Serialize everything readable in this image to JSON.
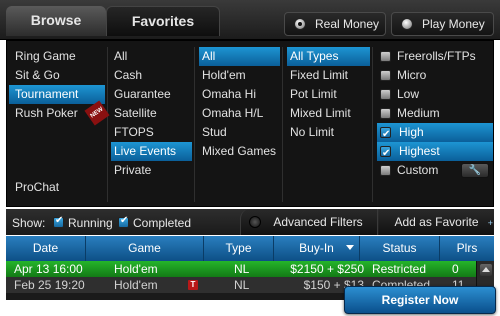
{
  "tabs": {
    "browse": "Browse",
    "favorites": "Favorites"
  },
  "money": {
    "real": "Real Money",
    "play": "Play Money",
    "selected": "real"
  },
  "game_types": {
    "items": [
      "Ring Game",
      "Sit & Go",
      "Tournament",
      "Rush Poker"
    ],
    "selected": "Tournament",
    "new_badge": "NEW",
    "prochat": "ProChat"
  },
  "categories": {
    "items": [
      "All",
      "Cash",
      "Guarantee",
      "Satellite",
      "FTOPS",
      "Live Events",
      "Private"
    ],
    "selected": "Live Events"
  },
  "games": {
    "items": [
      "All",
      "Hold'em",
      "Omaha Hi",
      "Omaha H/L",
      "Stud",
      "Mixed Games"
    ],
    "selected": "All"
  },
  "limits": {
    "items": [
      "All Types",
      "Fixed Limit",
      "Pot Limit",
      "Mixed Limit",
      "No Limit"
    ],
    "selected": "All Types"
  },
  "stakes": {
    "items": [
      {
        "label": "Freerolls/FTPs",
        "checked": false
      },
      {
        "label": "Micro",
        "checked": false
      },
      {
        "label": "Low",
        "checked": false
      },
      {
        "label": "Medium",
        "checked": false
      },
      {
        "label": "High",
        "checked": true
      },
      {
        "label": "Highest",
        "checked": true
      },
      {
        "label": "Custom",
        "checked": false
      }
    ]
  },
  "show_bar": {
    "label": "Show:",
    "running": "Running",
    "completed": "Completed",
    "advanced_filters": "Advanced Filters",
    "add_favorite": "Add as Favorite",
    "plus": "+"
  },
  "table": {
    "headers": [
      "Date",
      "Game",
      "Type",
      "Buy-In",
      "Status",
      "Plrs"
    ],
    "rows": [
      {
        "date": "Apr 13 16:00",
        "game": "Hold'em",
        "type": "NL",
        "buyin": "$2150 + $250",
        "status": "Restricted",
        "plrs": "0"
      },
      {
        "date": "Feb 25 19:20",
        "game": "Hold'em",
        "type": "NL",
        "buyin": "$150 + $13",
        "status": "Completed",
        "plrs": "11",
        "badge": "T"
      }
    ]
  },
  "register": "Register Now",
  "colors": {
    "accent": "#1d8fd0",
    "selected_row": "#1fa024",
    "badge_red": "#b81818"
  }
}
